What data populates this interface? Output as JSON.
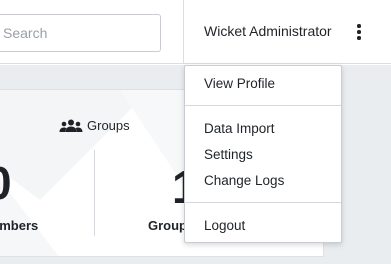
{
  "header": {
    "search_placeholder": "Search",
    "user_name": "Wicket Administrator",
    "more_icon": "vertical-ellipsis-icon"
  },
  "dashboard": {
    "groups_heading": "Groups",
    "groups_icon": "people-group-icon",
    "members_count_visible": "0",
    "members_label_visible": "embers",
    "groups_value_visible": "1",
    "groups_label_visible": "Group"
  },
  "user_menu": {
    "view_profile": "View Profile",
    "data_import": "Data Import",
    "settings": "Settings",
    "change_logs": "Change Logs",
    "logout": "Logout"
  },
  "colors": {
    "background": "#e9edf0",
    "card": "#ffffff",
    "border": "#c9ccd1",
    "text": "#1f2328"
  }
}
